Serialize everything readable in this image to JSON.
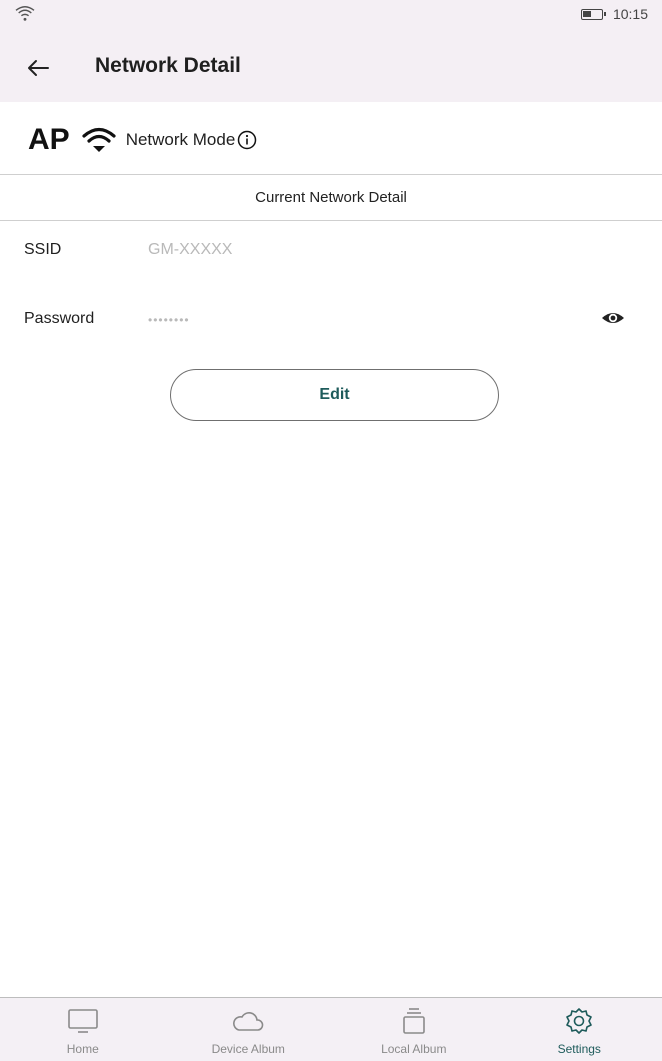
{
  "status_bar": {
    "time": "10:15"
  },
  "header": {
    "title": "Network Detail"
  },
  "mode": {
    "badge": "AP",
    "label": "Network Mode"
  },
  "section": {
    "title": "Current Network Detail"
  },
  "fields": {
    "ssid_label": "SSID",
    "ssid_value": "GM-XXXXX",
    "password_label": "Password",
    "password_value": "••••••••"
  },
  "actions": {
    "edit_label": "Edit"
  },
  "bottom_nav": {
    "items": [
      {
        "label": "Home",
        "icon": "monitor-icon"
      },
      {
        "label": "Device Album",
        "icon": "cloud-icon"
      },
      {
        "label": "Local Album",
        "icon": "album-stack-icon"
      },
      {
        "label": "Settings",
        "icon": "gear-icon",
        "active": true
      }
    ]
  },
  "colors": {
    "accent": "#1e5b5b",
    "topbar_bg": "#f4eff4",
    "divider": "#cfcfcf"
  }
}
